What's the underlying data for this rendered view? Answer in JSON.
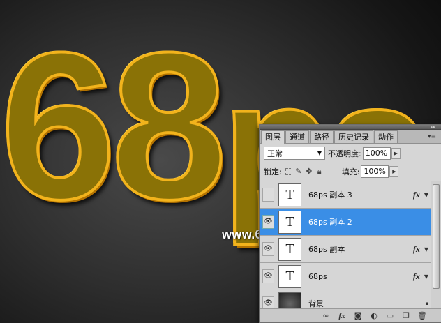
{
  "artwork": {
    "big_number": "68",
    "big_letters": "ps",
    "watermark": "www.68ps.com"
  },
  "panel": {
    "tabs": [
      {
        "label": "图层",
        "active": true
      },
      {
        "label": "通道",
        "active": false
      },
      {
        "label": "路径",
        "active": false
      },
      {
        "label": "历史记录",
        "active": false
      },
      {
        "label": "动作",
        "active": false
      }
    ],
    "menu_icon": "panel-menu-icon",
    "blend_mode": "正常",
    "opacity_label": "不透明度:",
    "opacity_value": "100%",
    "lock_label": "锁定:",
    "fill_label": "填充:",
    "fill_value": "100%",
    "layers": [
      {
        "name": "68ps 副本 3",
        "visible": false,
        "selected": false,
        "thumb": "T",
        "fx": "fx"
      },
      {
        "name": "68ps 副本 2",
        "visible": true,
        "selected": true,
        "thumb": "T",
        "fx": ""
      },
      {
        "name": "68ps 副本",
        "visible": true,
        "selected": false,
        "thumb": "T",
        "fx": "fx"
      },
      {
        "name": "68ps",
        "visible": true,
        "selected": false,
        "thumb": "T",
        "fx": "fx"
      },
      {
        "name": "背景",
        "visible": true,
        "selected": false,
        "thumb": "",
        "fx": ""
      }
    ],
    "footer_icons": [
      "link-icon",
      "fx-icon",
      "mask-icon",
      "adjustment-icon",
      "folder-icon",
      "new-layer-icon",
      "trash-icon"
    ],
    "selected_color": "#3a8ee6"
  }
}
